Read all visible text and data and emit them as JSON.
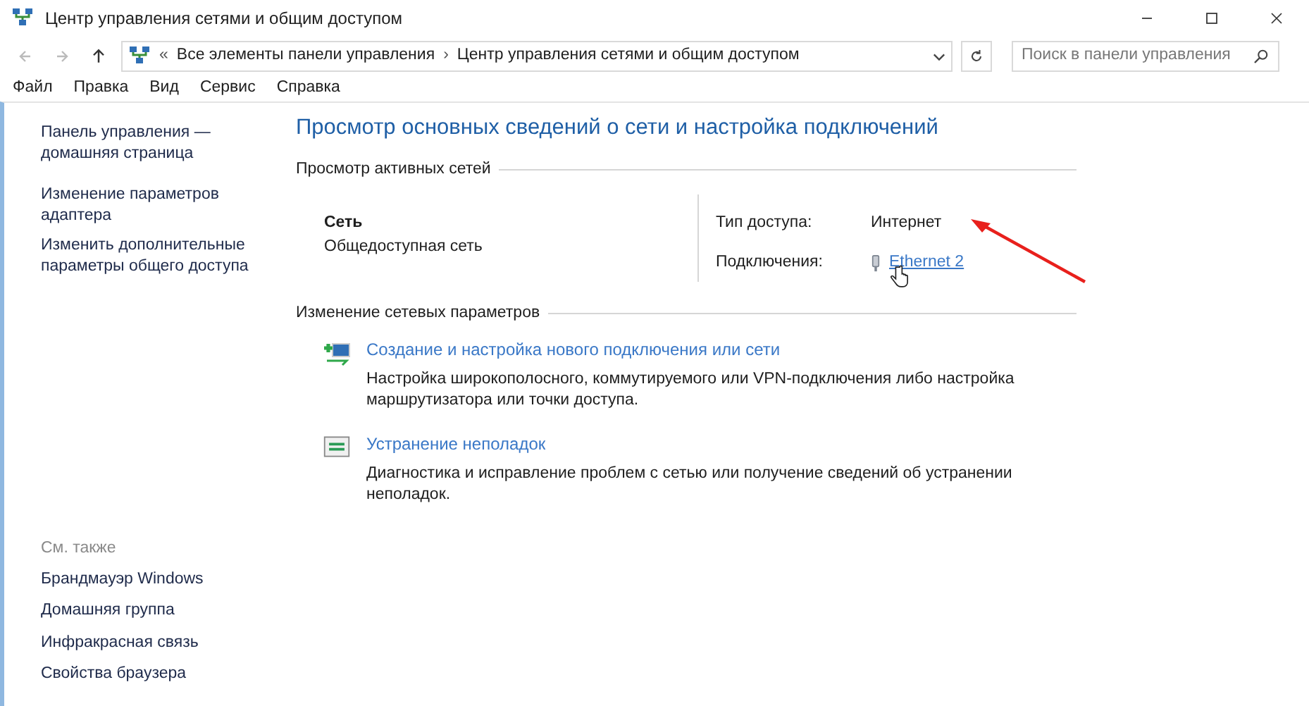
{
  "window": {
    "title": "Центр управления сетями и общим доступом"
  },
  "address_bar": {
    "prefix": "«",
    "breadcrumbs": [
      "Все элементы панели управления",
      "Центр управления сетями и общим доступом"
    ],
    "separator": "›"
  },
  "search": {
    "placeholder": "Поиск в панели управления"
  },
  "menu": [
    "Файл",
    "Правка",
    "Вид",
    "Сервис",
    "Справка"
  ],
  "sidebar": {
    "items": [
      {
        "label": "Панель управления —\nдомашняя страница"
      },
      {
        "label": "Изменение параметров\nадаптера"
      },
      {
        "label": "Изменить дополнительные\nпараметры общего доступа"
      }
    ],
    "see_also": {
      "heading": "См. также",
      "items": [
        "Брандмауэр Windows",
        "Домашняя группа",
        "Инфракрасная связь",
        "Свойства браузера"
      ]
    }
  },
  "main": {
    "title": "Просмотр основных сведений о сети и настройка подключений",
    "active_networks": {
      "heading": "Просмотр активных сетей",
      "network_name": "Сеть",
      "network_type": "Общедоступная сеть",
      "access_label": "Тип доступа:",
      "access_value": "Интернет",
      "connections_label": "Подключения:",
      "connection_link": "Ethernet 2"
    },
    "change_settings": {
      "heading": "Изменение сетевых параметров",
      "tasks": [
        {
          "kind": "new-connection",
          "link": "Создание и настройка нового подключения или сети",
          "description": "Настройка широкополосного, коммутируемого или VPN-подключения либо настройка маршрутизатора или точки доступа."
        },
        {
          "kind": "troubleshoot",
          "link": "Устранение неполадок",
          "description": "Диагностика и исправление проблем с сетью или получение сведений об устранении неполадок."
        }
      ]
    }
  }
}
